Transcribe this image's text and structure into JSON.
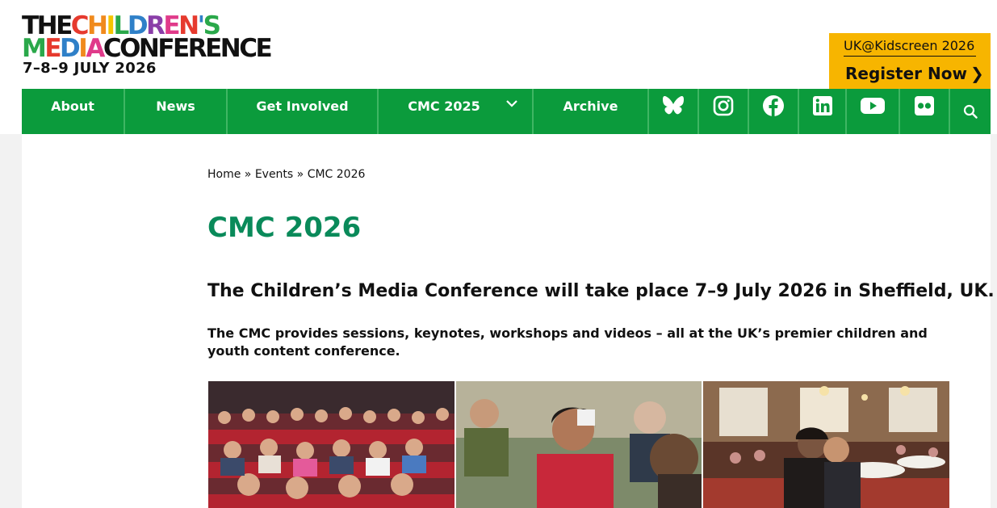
{
  "logo": {
    "line1_a": "THE",
    "line1_b": "CHILDREN'S",
    "line2_a": "MEDIA",
    "line2_b": "CONFERENCE",
    "dates": "7–8–9 JULY 2026"
  },
  "promo": {
    "line1": "UK@Kidscreen 2026",
    "line2": "Register Now",
    "chevron": "❯"
  },
  "nav": {
    "items": [
      {
        "label": "About"
      },
      {
        "label": "News"
      },
      {
        "label": "Get Involved"
      },
      {
        "label": "CMC 2025"
      },
      {
        "label": "Archive"
      }
    ],
    "icons": [
      "bluesky-icon",
      "instagram-icon",
      "facebook-icon",
      "linkedin-icon",
      "youtube-icon",
      "flickr-icon",
      "search-icon"
    ]
  },
  "breadcrumb": {
    "home": "Home",
    "sep1": " » ",
    "events": "Events",
    "sep2": " » ",
    "current": "CMC 2026"
  },
  "page": {
    "title": "CMC 2026",
    "lead": "The Children’s Media Conference will take place 7–9 July 2026 in Sheffield, UK.",
    "sub": "The CMC provides sessions, keynotes, workshops and videos – all at the UK’s premier children and youth content conference."
  },
  "photos": [
    {
      "label": "conference-audience-photo"
    },
    {
      "label": "networking-attendees-photo"
    },
    {
      "label": "ballroom-event-photo"
    }
  ],
  "colors": {
    "nav_green": "#0b9b3c",
    "title_green": "#0a8a5a",
    "promo_yellow": "#f7b500",
    "logo_red": "#e63a2e",
    "logo_orange": "#f08a1c",
    "logo_yellow": "#f5c400",
    "logo_green": "#2aa84a",
    "logo_blue": "#2f80c8",
    "logo_purple": "#8a3ea8",
    "logo_pink": "#e03a8a"
  }
}
